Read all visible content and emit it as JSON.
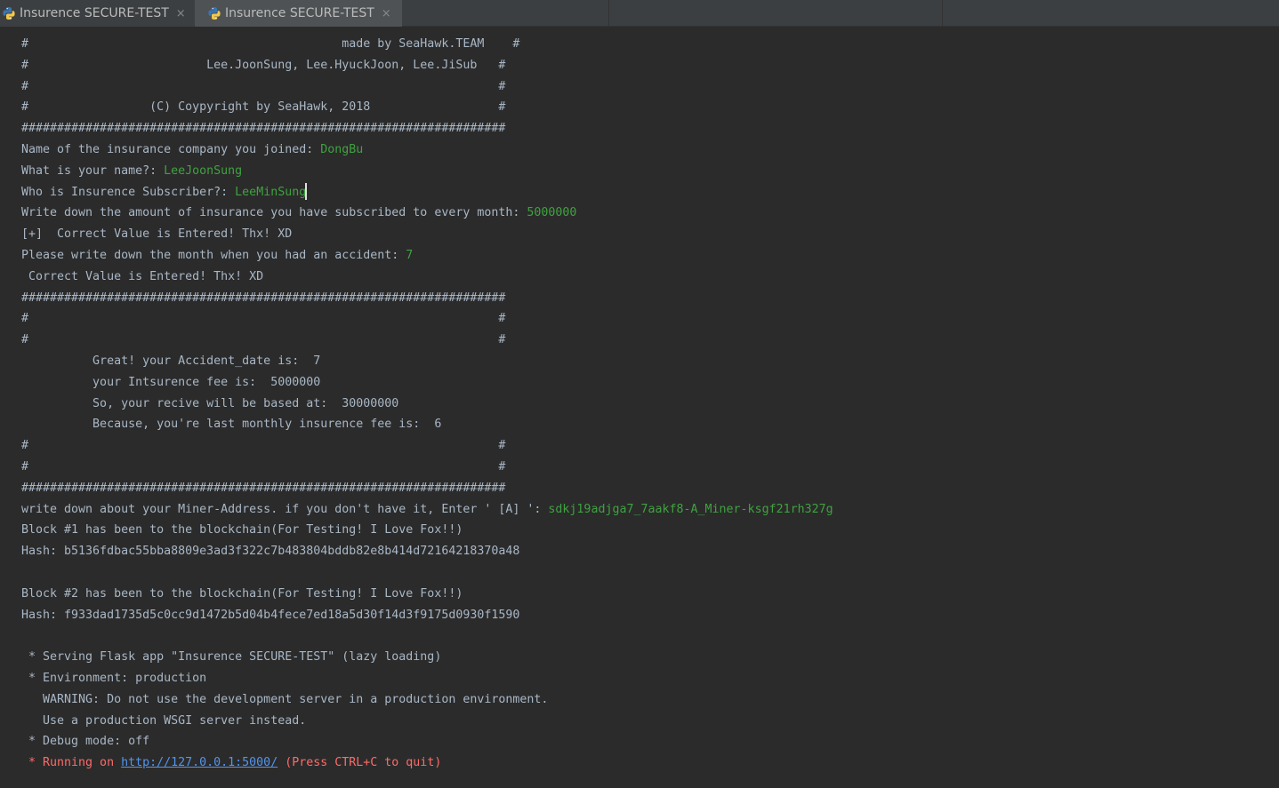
{
  "tabs": [
    {
      "label": "Insurence SECURE-TEST",
      "icon": "python-icon",
      "active": false
    },
    {
      "label": "Insurence SECURE-TEST",
      "icon": "python-icon",
      "active": true
    }
  ],
  "close_glyph": "×",
  "console": {
    "banner_top": [
      "#                                            made by SeaHawk.TEAM    #",
      "#                         Lee.JoonSung, Lee.HyuckJoon, Lee.JiSub   #",
      "#                                                                  #",
      "#                 (C) Coypyright by SeaHawk, 2018                  #",
      "####################################################################"
    ],
    "q_company": "Name of the insurance company you joined: ",
    "a_company": "DongBu",
    "q_name": "What is your name?: ",
    "a_name": "LeeJoonSung",
    "q_subscriber": "Who is Insurence Subscriber?: ",
    "a_subscriber": "LeeMinSung",
    "q_amount": "Write down the amount of insurance you have subscribed to every month: ",
    "a_amount": "5000000",
    "msg_correct_1": "[+]  Correct Value is Entered! Thx! XD",
    "q_month": "Please write down the month when you had an accident: ",
    "a_month": "7",
    "msg_correct_2": " Correct Value is Entered! Thx! XD",
    "banner_mid": [
      "####################################################################",
      "#                                                                  #",
      "#                                                                  #",
      "          Great! your Accident_date is:  7",
      "          your Intsurence fee is:  5000000",
      "          So, your recive will be based at:  30000000",
      "          Because, you're last monthly insurence fee is:  6",
      "#                                                                  #",
      "#                                                                  #",
      "####################################################################"
    ],
    "q_miner": "write down about your Miner-Address. if you don't have it, Enter ' [A] ': ",
    "a_miner": "sdkj19adjga7_7aakf8-A_Miner-ksgf21rh327g",
    "block1": "Block #1 has been to the blockchain(For Testing! I Love Fox!!)",
    "hash1": "Hash: b5136fdbac55bba8809e3ad3f322c7b483804bddb82e8b414d72164218370a48",
    "block2": "Block #2 has been to the blockchain(For Testing! I Love Fox!!)",
    "hash2": "Hash: f933dad1735d5c0cc9d1472b5d04b4fece7ed18a5d30f14d3f9175d0930f1590",
    "flask_serving": " * Serving Flask app \"Insurence SECURE-TEST\" (lazy loading)",
    "flask_env": " * Environment: production",
    "flask_warning": "   WARNING: Do not use the development server in a production environment.",
    "flask_wsgi": "   Use a production WSGI server instead.",
    "flask_debug": " * Debug mode: off",
    "running_prefix": " * Running on ",
    "running_url": "http://127.0.0.1:5000/",
    "running_suffix": " (Press CTRL+C to quit)"
  },
  "colors": {
    "background": "#2b2b2b",
    "text": "#a9b7c6",
    "user_input": "#3fa23f",
    "stderr": "#ff6b68",
    "link": "#5394ec"
  }
}
